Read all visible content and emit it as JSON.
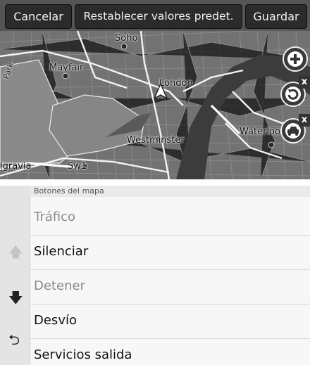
{
  "top_bar": {
    "cancel_label": "Cancelar",
    "reset_label": "Restablecer valores predet.",
    "save_label": "Guardar"
  },
  "map": {
    "labels": {
      "soho": "Soho",
      "mayfair": "Mayfair",
      "park": "Park",
      "london": "London",
      "westminster": "Westminster",
      "waterloo": "Waterloo",
      "belgravia": "lgravia",
      "sw1": "Sw1"
    },
    "buttons": [
      {
        "icon": "zoom-in-icon"
      },
      {
        "icon": "route-recalc-icon",
        "badge": "x"
      },
      {
        "icon": "vehicle-icon",
        "badge": "x"
      }
    ],
    "colors": {
      "roads": "#ffffff",
      "river": "#3b3b3b",
      "park": "#8c8c8c"
    }
  },
  "list": {
    "header": "Botones del mapa",
    "items": [
      {
        "label": "Tráfico",
        "state": "disabled"
      },
      {
        "label": "Silenciar",
        "state": "enabled"
      },
      {
        "label": "Detener",
        "state": "disabled"
      },
      {
        "label": "Desvío",
        "state": "enabled"
      },
      {
        "label": "Servicios salida",
        "state": "enabled"
      }
    ],
    "rail_icons": [
      "arrow-up-icon",
      "arrow-down-icon",
      "back-icon"
    ]
  }
}
